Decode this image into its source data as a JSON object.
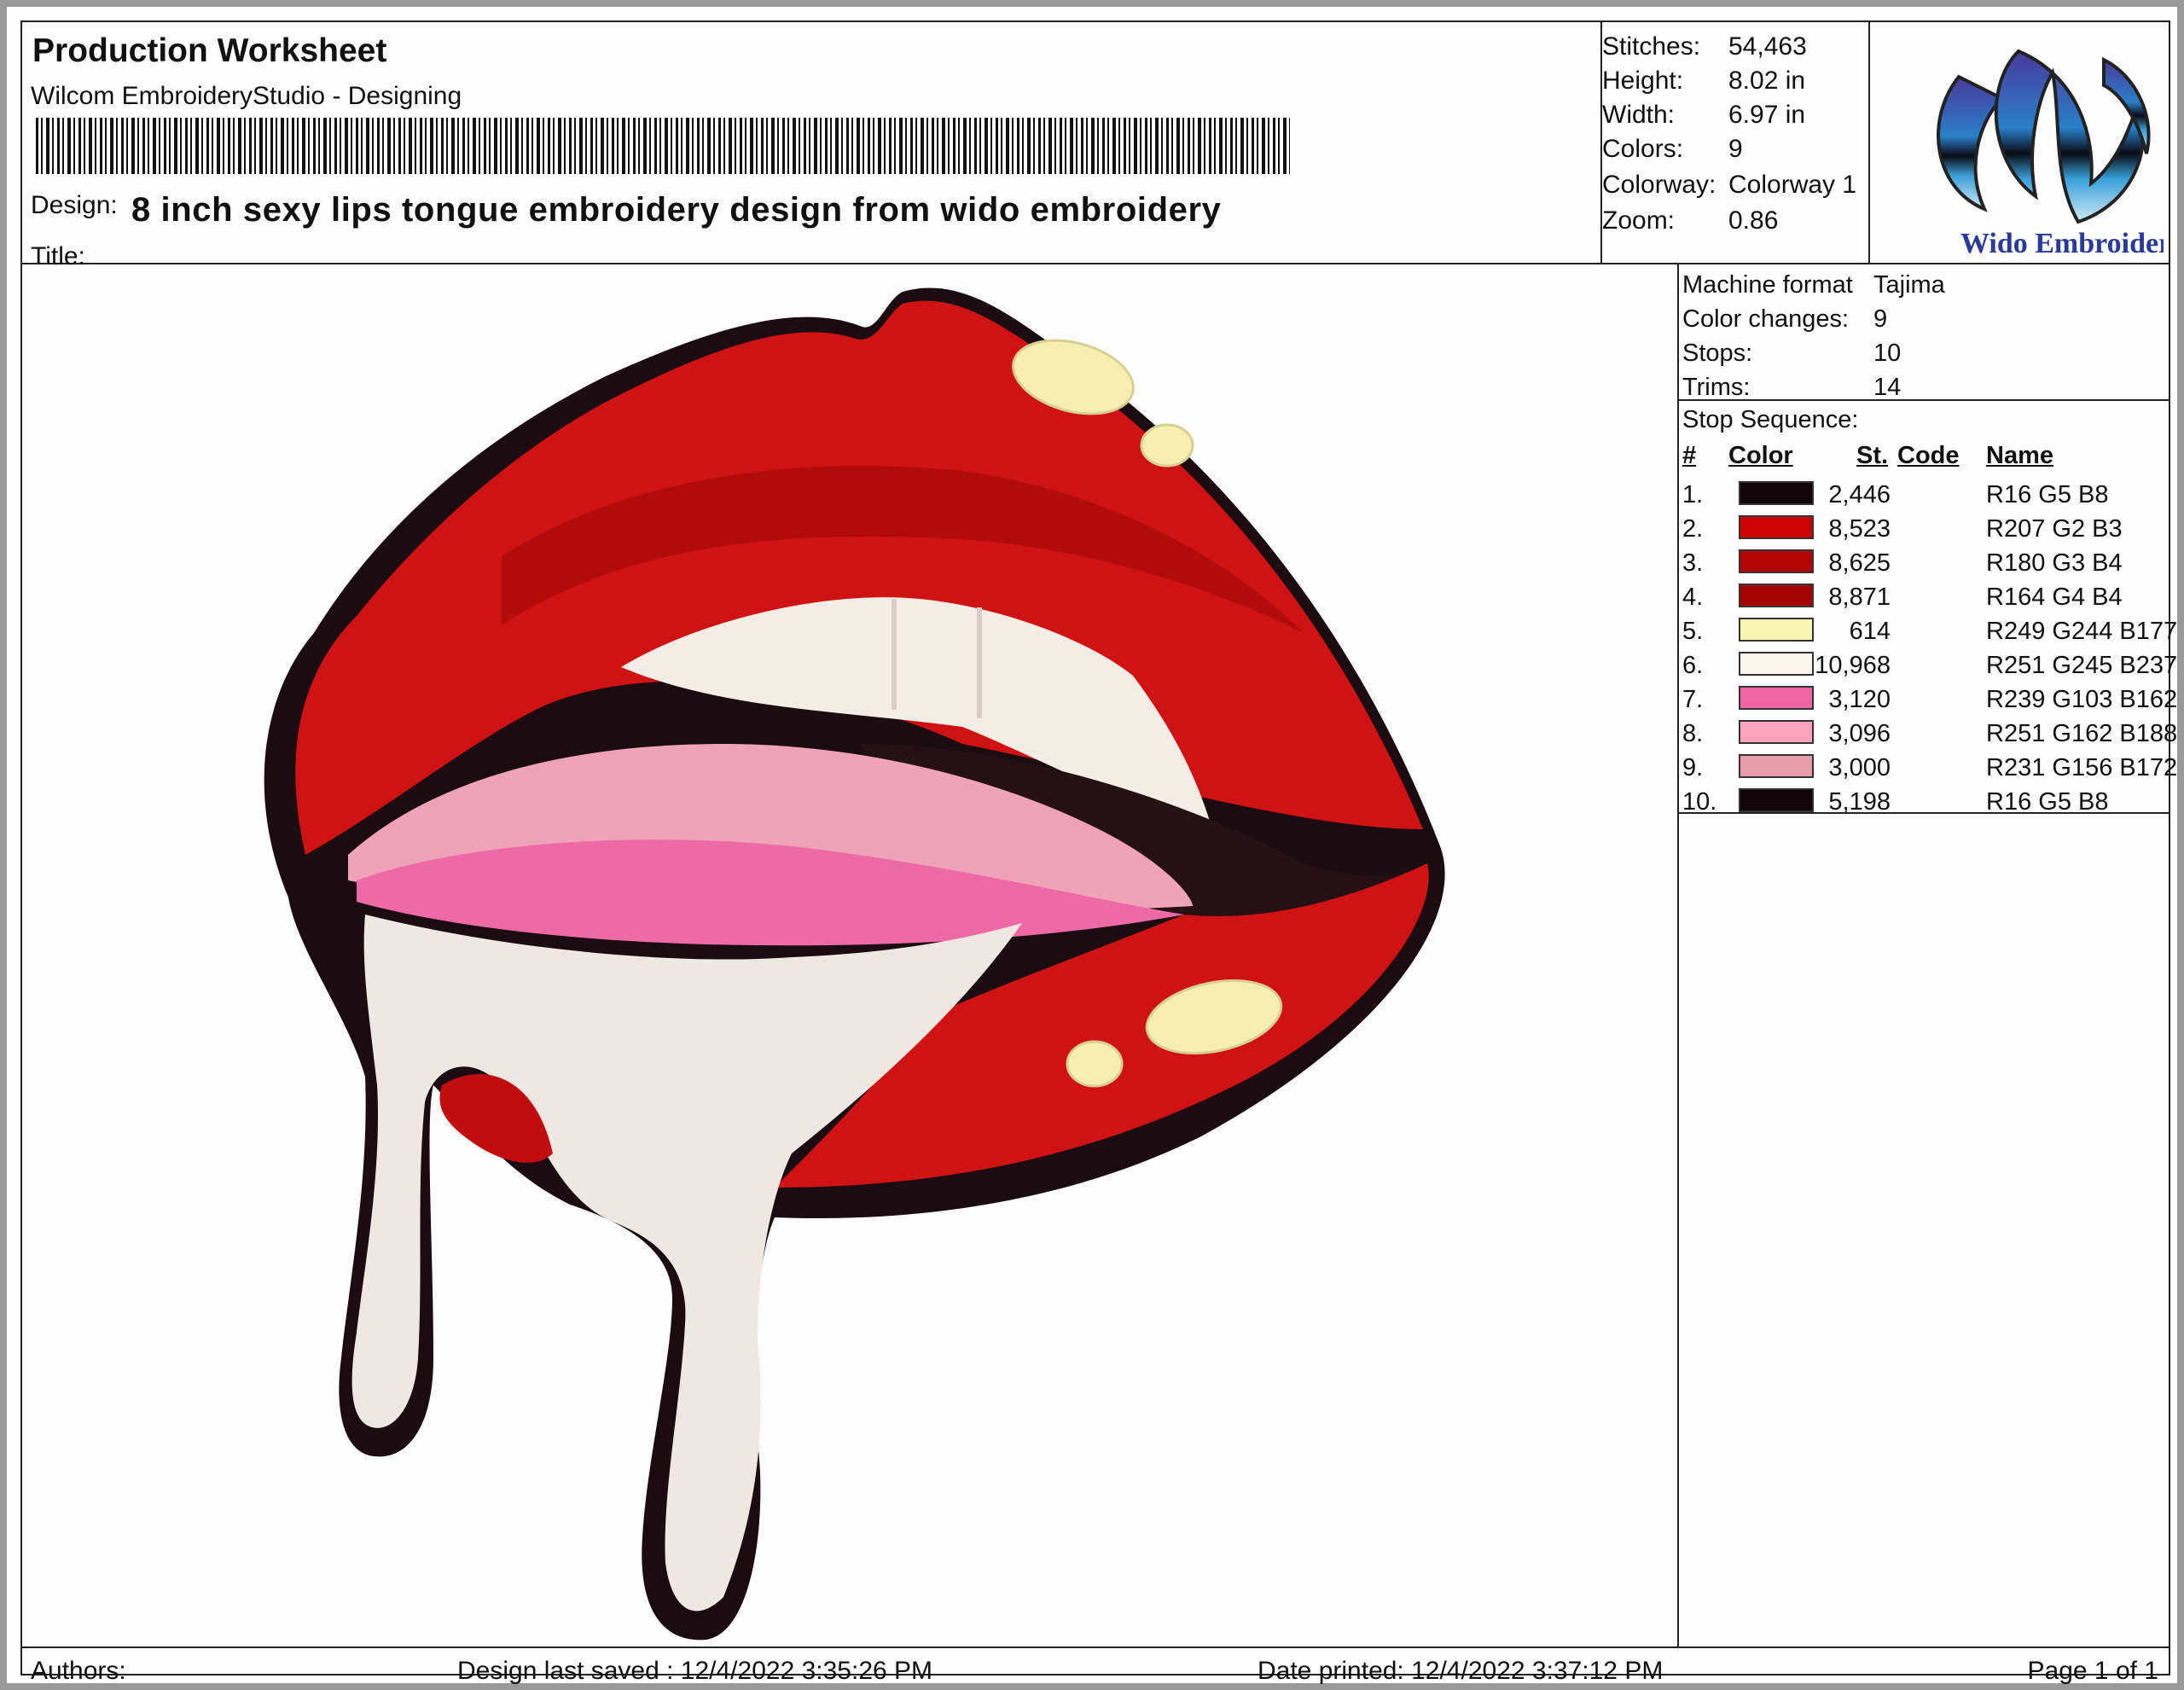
{
  "header": {
    "title": "Production Worksheet",
    "app": "Wilcom EmbroideryStudio - Designing",
    "design_label": "Design:",
    "design_name": "8 inch sexy lips tongue embroidery design from wido embroidery",
    "title_label": "Title:",
    "title_value": ""
  },
  "stats": [
    {
      "label": "Stitches:",
      "value": "54,463"
    },
    {
      "label": "Height:",
      "value": "8.02 in"
    },
    {
      "label": "Width:",
      "value": "6.97 in"
    },
    {
      "label": "Colors:",
      "value": "9"
    },
    {
      "label": "Colorway:",
      "value": "Colorway 1"
    },
    {
      "label": "Zoom:",
      "value": "0.86"
    }
  ],
  "logo": {
    "icon": "wido-logo",
    "text": "Wido Embroidery"
  },
  "machine": [
    {
      "label": "Machine format",
      "value": "Tajima"
    },
    {
      "label": "Color changes:",
      "value": "9"
    },
    {
      "label": "Stops:",
      "value": "10"
    },
    {
      "label": "Trims:",
      "value": "14"
    }
  ],
  "stop_sequence": {
    "label": "Stop Sequence:",
    "columns": {
      "num": "#",
      "color": "Color",
      "stitches": "St.",
      "code": "Code",
      "name": "Name"
    },
    "rows": [
      {
        "num": "1.",
        "color": "#100508",
        "stitches": "2,446",
        "code": "",
        "name": "R16 G5 B8"
      },
      {
        "num": "2.",
        "color": "#cf0203",
        "stitches": "8,523",
        "code": "",
        "name": "R207 G2 B3"
      },
      {
        "num": "3.",
        "color": "#b40304",
        "stitches": "8,625",
        "code": "",
        "name": "R180 G3 B4"
      },
      {
        "num": "4.",
        "color": "#a40404",
        "stitches": "8,871",
        "code": "",
        "name": "R164 G4 B4"
      },
      {
        "num": "5.",
        "color": "#f9f4b1",
        "stitches": "614",
        "code": "",
        "name": "R249 G244 B177"
      },
      {
        "num": "6.",
        "color": "#fbf5ed",
        "stitches": "10,968",
        "code": "",
        "name": "R251 G245 B237"
      },
      {
        "num": "7.",
        "color": "#ef67a2",
        "stitches": "3,120",
        "code": "",
        "name": "R239 G103 B162"
      },
      {
        "num": "8.",
        "color": "#fba2bc",
        "stitches": "3,096",
        "code": "",
        "name": "R251 G162 B188"
      },
      {
        "num": "9.",
        "color": "#e79cac",
        "stitches": "3,000",
        "code": "",
        "name": "R231 G156 B172"
      },
      {
        "num": "10.",
        "color": "#100508",
        "stitches": "5,198",
        "code": "",
        "name": "R16 G5 B8"
      }
    ]
  },
  "footer": {
    "authors": "Authors:",
    "saved": "Design last saved : 12/4/2022 3:35:26 PM",
    "printed": "Date printed: 12/4/2022 3:37:12 PM",
    "page": "Page 1 of 1"
  },
  "artwork": {
    "icon": "dripping-lips-embroidery"
  }
}
